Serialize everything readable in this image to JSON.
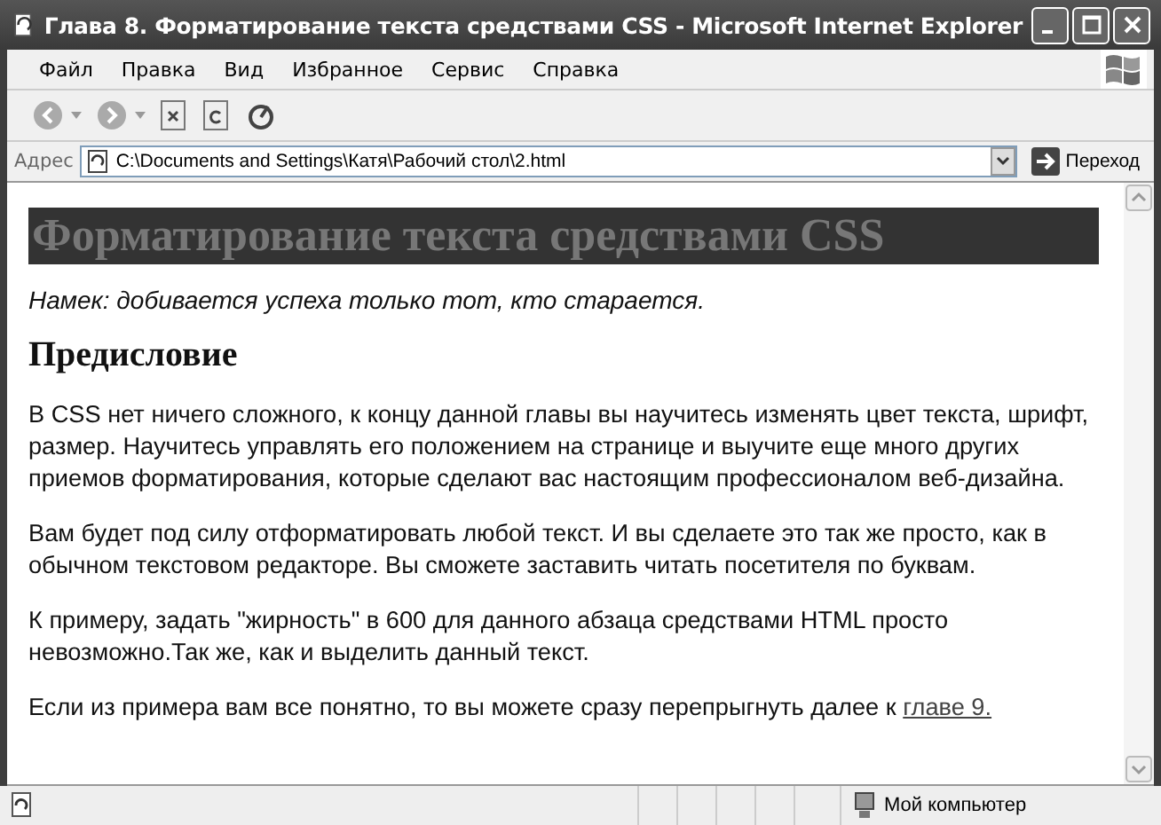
{
  "window": {
    "title": "Глава 8. Форматирование текста средствами CSS - Microsoft Internet Explorer"
  },
  "menu": [
    "Файл",
    "Правка",
    "Вид",
    "Избранное",
    "Сервис",
    "Справка"
  ],
  "address": {
    "label": "Адрес",
    "value": "C:\\Documents and Settings\\Катя\\Рабочий стол\\2.html"
  },
  "go_button": "Переход",
  "page": {
    "banner": "Форматирование текста средствами CSS",
    "hint": "Намек: добивается успеха только тот, кто старается.",
    "heading": "Предисловие",
    "paragraphs": [
      {
        "text": "В CSS нет ничего сложного, к концу данной главы вы научитесь изменять цвет текста, шрифт, размер. Научитесь управлять его положением на странице и выучите еще много других приемов форматирования, которые сделают вас настоящим профессионалом веб-дизайна."
      },
      {
        "text": "Вам будет под силу отформатировать любой текст. И вы сделаете это так же просто, как в обычном текстовом редакторе. Вы сможете заставить читать посетителя по буквам."
      },
      {
        "text": "К примеру, задать \"жирность\" в 600 для данного абзаца средствами HTML просто невозможно.Так же, как и выделить данный текст."
      },
      {
        "text": "Если из примера вам все понятно, то вы можете сразу перепрыгнуть далее к ",
        "link": "главе 9."
      }
    ]
  },
  "status_bar": {
    "zone": "Мой компьютер"
  }
}
